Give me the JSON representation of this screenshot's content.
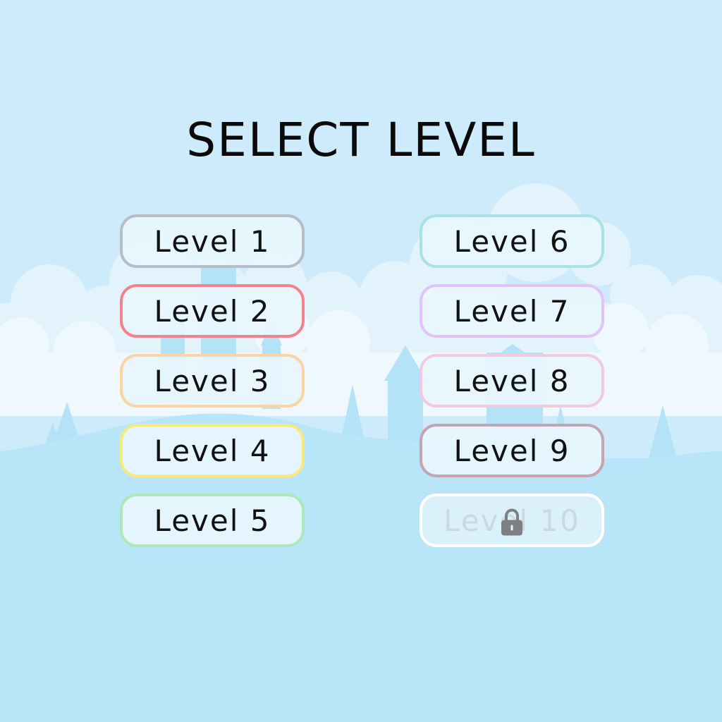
{
  "title": "SELECT LEVEL",
  "levels": [
    {
      "label": "Level 1",
      "border": "#b7bccb",
      "locked": false
    },
    {
      "label": "Level 2",
      "border": "#f2838a",
      "locked": false
    },
    {
      "label": "Level 3",
      "border": "#fcd4a4",
      "locked": false
    },
    {
      "label": "Level 4",
      "border": "#f8e97c",
      "locked": false
    },
    {
      "label": "Level 5",
      "border": "#aee7bb",
      "locked": false
    },
    {
      "label": "Level 6",
      "border": "#a8e2e4",
      "locked": false
    },
    {
      "label": "Level 7",
      "border": "#e3c3f7",
      "locked": false
    },
    {
      "label": "Level 8",
      "border": "#f1cae2",
      "locked": false
    },
    {
      "label": "Level 9",
      "border": "#c4a5b1",
      "locked": false
    },
    {
      "label": "Level 10",
      "border": "#ffffff",
      "locked": true
    }
  ],
  "icons": {
    "locked_level": "lock-icon"
  },
  "colors": {
    "sky": "#cdebfa",
    "clouds": "#e6f5fd",
    "silhouette": "#aee0f5",
    "ground": "#b9e5f8"
  }
}
